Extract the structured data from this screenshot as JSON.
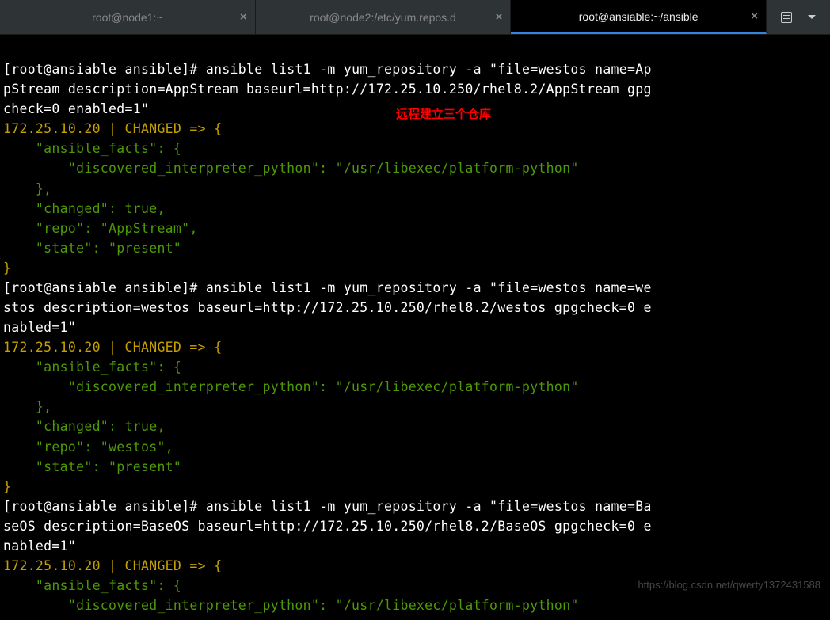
{
  "tabs": [
    {
      "label": "root@node1:~",
      "active": false
    },
    {
      "label": "root@node2:/etc/yum.repos.d",
      "active": false
    },
    {
      "label": "root@ansiable:~/ansible",
      "active": true
    }
  ],
  "annotation": "远程建立三个仓库",
  "watermark": "https://blog.csdn.net/qwerty1372431588",
  "term": {
    "prompt": "[root@ansiable ansible]# ",
    "cmd1_l1": "ansible list1 -m yum_repository -a \"file=westos name=Ap",
    "cmd1_l2": "pStream description=AppStream baseurl=http://172.25.10.250/rhel8.2/AppStream gpg",
    "cmd1_l3": "check=0 enabled=1\"",
    "out1_l1": "172.25.10.20 | CHANGED => {",
    "out1_l2": "    \"ansible_facts\": {",
    "out1_l3": "        \"discovered_interpreter_python\": \"/usr/libexec/platform-python\"",
    "out1_l4": "    },",
    "out1_l5": "    \"changed\": true,",
    "out1_l6": "    \"repo\": \"AppStream\",",
    "out1_l7": "    \"state\": \"present\"",
    "out1_l8": "}",
    "cmd2_l1": "ansible list1 -m yum_repository -a \"file=westos name=we",
    "cmd2_l2": "stos description=westos baseurl=http://172.25.10.250/rhel8.2/westos gpgcheck=0 e",
    "cmd2_l3": "nabled=1\"",
    "out2_l1": "172.25.10.20 | CHANGED => {",
    "out2_l2": "    \"ansible_facts\": {",
    "out2_l3": "        \"discovered_interpreter_python\": \"/usr/libexec/platform-python\"",
    "out2_l4": "    },",
    "out2_l5": "    \"changed\": true,",
    "out2_l6": "    \"repo\": \"westos\",",
    "out2_l7": "    \"state\": \"present\"",
    "out2_l8": "}",
    "cmd3_l1": "ansible list1 -m yum_repository -a \"file=westos name=Ba",
    "cmd3_l2": "seOS description=BaseOS baseurl=http://172.25.10.250/rhel8.2/BaseOS gpgcheck=0 e",
    "cmd3_l3": "nabled=1\"",
    "out3_l1": "172.25.10.20 | CHANGED => {",
    "out3_l2": "    \"ansible_facts\": {",
    "out3_l3a": "        \"discovered_interpreter_python\": \"/usr/libexec/plat",
    "out3_l3b": "form-python\""
  }
}
